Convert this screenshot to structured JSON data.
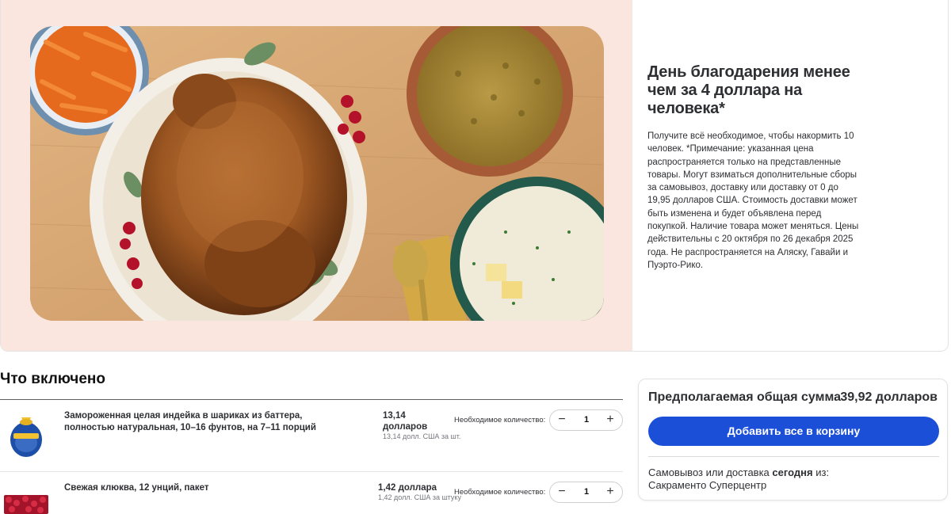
{
  "hero": {
    "title": "День благодарения менее чем за 4 доллара на человека*",
    "description": "Получите всё необходимое, чтобы накормить 10 человек. *Примечание: указанная цена распространяется только на представленные товары. Могут взиматься дополнительные сборы за самовывоз, доставку или доставку от 0 до 19,95 долларов США. Стоимость доставки может быть изменена и будет объявлена перед покупкой. Наличие товара может меняться. Цены действительны с 20 октября по 26 декабря 2025 года. Не распространяется на Аляску, Гавайи и Пуэрто-Рико."
  },
  "included": {
    "title": "Что включено",
    "items": [
      {
        "name": "Замороженная целая индейка в шариках из баттера, полностью натуральная, 10–16 фунтов, на 7–11 порций",
        "price_line1": "13,14",
        "price_line2": "долларов",
        "unit_price": "13,14 долл. США за шт.",
        "qty_label": "Необходимое количество:",
        "qty": "1",
        "minus": "−",
        "plus": "+"
      },
      {
        "name": "Свежая клюква, 12 унций, пакет",
        "price_line1": "1,42 доллара",
        "unit_price": "1,42 долл. США за штуку",
        "qty_label": "Необходимое количество:",
        "qty": "1",
        "minus": "−",
        "plus": "+"
      }
    ]
  },
  "summary": {
    "label": "Предполагаемая общая сумма",
    "value": "39,92 долларов",
    "add_button": "Добавить все в корзину",
    "pickup_prefix": "Самовывоз или доставка",
    "pickup_day": "сегодня",
    "pickup_suffix": "из:",
    "store": "Сакраменто Суперцентр"
  }
}
